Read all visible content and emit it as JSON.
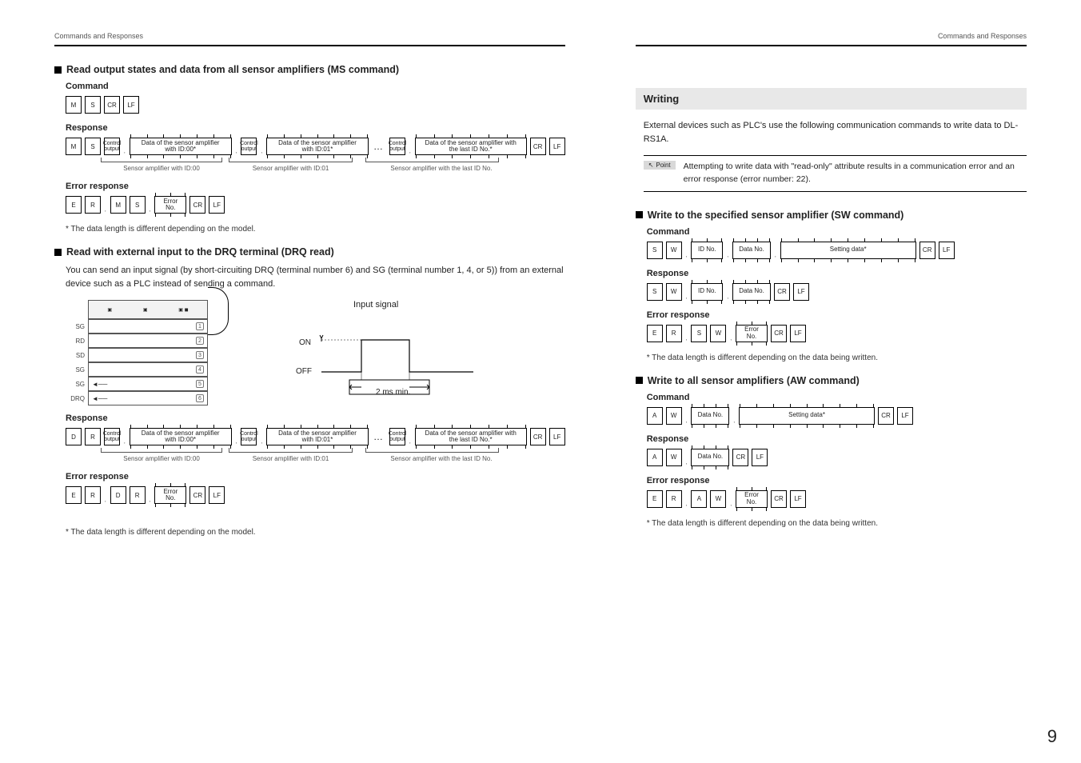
{
  "header": {
    "left": "Commands and Responses",
    "right": "Commands and Responses"
  },
  "page_number": "9",
  "left": {
    "sec1_title": "Read output states and data from all sensor amplifiers (MS command)",
    "command_h": "Command",
    "ms_cmd": {
      "c0": "M",
      "c1": "S",
      "c2": "CR",
      "c3": "LF"
    },
    "response_h": "Response",
    "ms_resp": {
      "c0": "M",
      "c1": "S",
      "ctrl": "Control output",
      "data0": "Data of the sensor amplifier with ID:00*",
      "data1": "Data of the sensor amplifier with ID:01*",
      "dataN": "Data of the sensor amplifier with the last ID No.*",
      "sub0": "Sensor amplifier with ID:00",
      "sub1": "Sensor amplifier with ID:01",
      "subN": "Sensor amplifier with the last ID No.",
      "cr": "CR",
      "lf": "LF"
    },
    "error_h": "Error response",
    "ms_err": {
      "c0": "E",
      "c1": "R",
      "c2": "M",
      "c3": "S",
      "err": "Error No.",
      "cr": "CR",
      "lf": "LF"
    },
    "note1": "* The data length is different depending on the model.",
    "sec2_title": "Read with external input to the DRQ terminal (DRQ read)",
    "sec2_body": "You can send an input signal (by short-circuiting DRQ (terminal number 6) and SG (terminal number 1, 4, or 5)) from an external device such as a PLC instead of sending a command.",
    "conn_labels": {
      "l1": "SG",
      "l2": "RD",
      "l3": "SD",
      "l4": "SG",
      "l5": "SG",
      "l6": "DRQ"
    },
    "signal": {
      "title": "Input signal",
      "on": "ON",
      "off": "OFF",
      "pulse": "2 ms min."
    },
    "dr_resp": {
      "c0": "D",
      "c1": "R",
      "ctrl": "Control output",
      "data0": "Data of the sensor amplifier with ID:00*",
      "data1": "Data of the sensor amplifier with ID:01*",
      "dataN": "Data of the sensor amplifier with the last ID No.*",
      "sub0": "Sensor amplifier with ID:00",
      "sub1": "Sensor amplifier with ID:01",
      "subN": "Sensor amplifier with the last ID No.",
      "cr": "CR",
      "lf": "LF"
    },
    "dr_err": {
      "c0": "E",
      "c1": "R",
      "c2": "D",
      "c3": "R",
      "err": "Error No.",
      "cr": "CR",
      "lf": "LF"
    },
    "note2": "* The data length is different depending on the model."
  },
  "right": {
    "writing_h": "Writing",
    "writing_body": "External devices such as PLC's use the following communication commands to write data to DL-RS1A.",
    "point_tag": "Point",
    "point_text": "Attempting to write data with \"read-only\" attribute results in a communication error and an error response (error number: 22).",
    "sec_sw_title": "Write to the specified sensor amplifier (SW command)",
    "command_h": "Command",
    "response_h": "Response",
    "error_h": "Error response",
    "sw_cmd": {
      "c0": "S",
      "c1": "W",
      "id": "ID No.",
      "dno": "Data No.",
      "set": "Setting data*",
      "cr": "CR",
      "lf": "LF"
    },
    "sw_resp": {
      "c0": "S",
      "c1": "W",
      "id": "ID No.",
      "dno": "Data No.",
      "cr": "CR",
      "lf": "LF"
    },
    "sw_err": {
      "c0": "E",
      "c1": "R",
      "c2": "S",
      "c3": "W",
      "err": "Error No.",
      "cr": "CR",
      "lf": "LF"
    },
    "note_sw": "* The data length is different depending on the data being written.",
    "sec_aw_title": "Write to all sensor amplifiers (AW command)",
    "aw_cmd": {
      "c0": "A",
      "c1": "W",
      "dno": "Data No.",
      "set": "Setting data*",
      "cr": "CR",
      "lf": "LF"
    },
    "aw_resp": {
      "c0": "A",
      "c1": "W",
      "dno": "Data No.",
      "cr": "CR",
      "lf": "LF"
    },
    "aw_err": {
      "c0": "E",
      "c1": "R",
      "c2": "A",
      "c3": "W",
      "err": "Error No.",
      "cr": "CR",
      "lf": "LF"
    },
    "note_aw": "* The data length is different depending on the data being written."
  }
}
